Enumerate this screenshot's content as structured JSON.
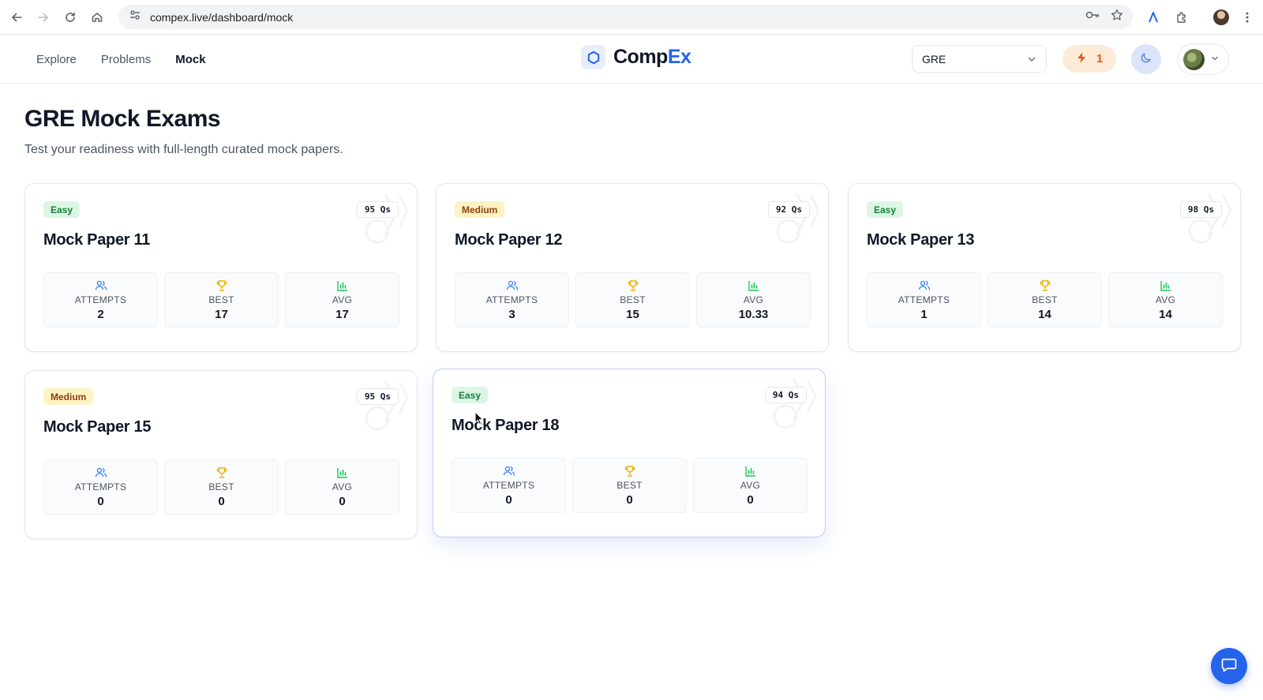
{
  "browser": {
    "url": "compex.live/dashboard/mock"
  },
  "header": {
    "nav": [
      {
        "label": "Explore",
        "active": false
      },
      {
        "label": "Problems",
        "active": false
      },
      {
        "label": "Mock",
        "active": true
      }
    ],
    "brand": {
      "part1": "Comp",
      "part2": "Ex"
    },
    "exam_select": {
      "value": "GRE"
    },
    "streak": {
      "count": "1"
    }
  },
  "page": {
    "title": "GRE Mock Exams",
    "subtitle": "Test your readiness with full-length curated mock papers."
  },
  "stat_labels": {
    "attempts": "ATTEMPTS",
    "best": "BEST",
    "avg": "AVG"
  },
  "cards": [
    {
      "difficulty": "Easy",
      "questions": "95 Qs",
      "title": "Mock Paper 11",
      "attempts": "2",
      "best": "17",
      "avg": "17"
    },
    {
      "difficulty": "Medium",
      "questions": "92 Qs",
      "title": "Mock Paper 12",
      "attempts": "3",
      "best": "15",
      "avg": "10.33"
    },
    {
      "difficulty": "Easy",
      "questions": "98 Qs",
      "title": "Mock Paper 13",
      "attempts": "1",
      "best": "14",
      "avg": "14"
    },
    {
      "difficulty": "Medium",
      "questions": "95 Qs",
      "title": "Mock Paper 15",
      "attempts": "0",
      "best": "0",
      "avg": "0"
    },
    {
      "difficulty": "Easy",
      "questions": "94 Qs",
      "title": "Mock Paper 18",
      "attempts": "0",
      "best": "0",
      "avg": "0"
    }
  ],
  "colors": {
    "accent": "#2563eb",
    "easy_bg": "#dcf5e4",
    "easy_text": "#15803d",
    "medium_bg": "#fdf3c3",
    "medium_text": "#92400e",
    "streak": "#ea580c"
  }
}
